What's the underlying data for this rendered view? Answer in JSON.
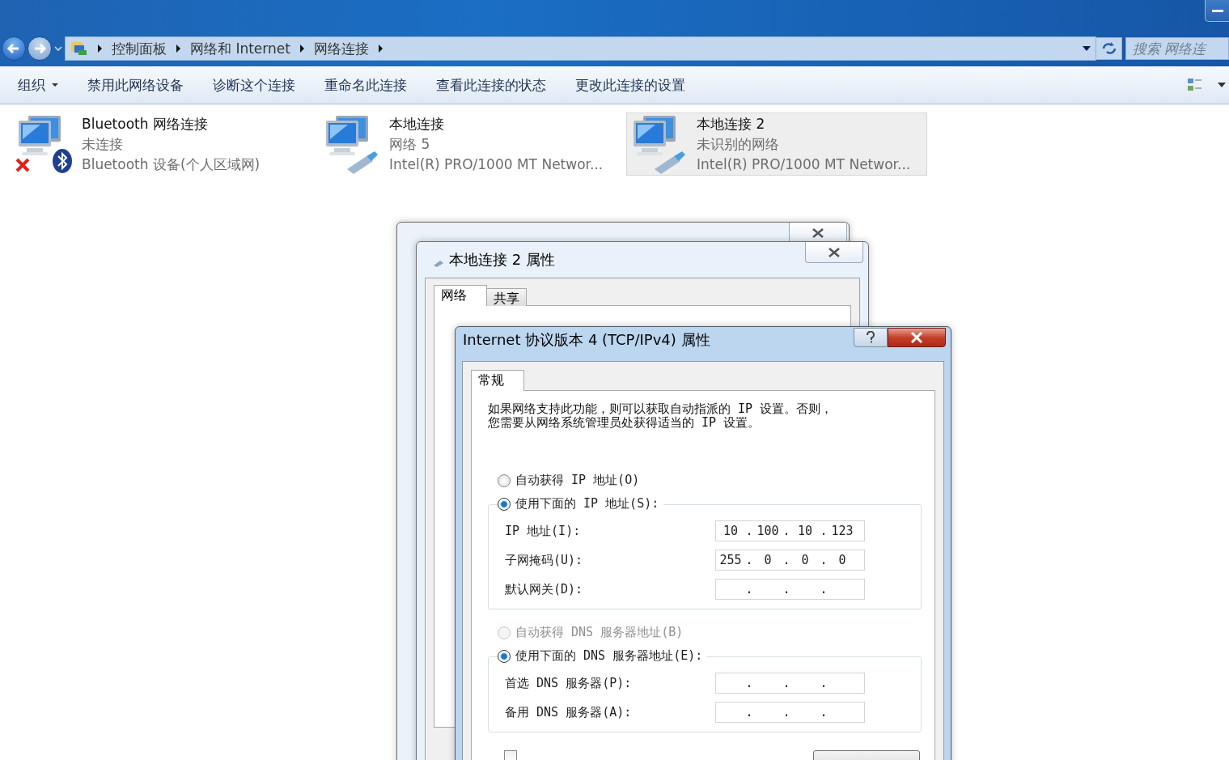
{
  "explorer": {
    "breadcrumb": [
      "控制面板",
      "网络和 Internet",
      "网络连接"
    ],
    "search": {
      "placeholder": "搜索 网络连"
    }
  },
  "toolbar": [
    {
      "label": "组织",
      "dropdown": true
    },
    {
      "label": "禁用此网络设备",
      "dropdown": false
    },
    {
      "label": "诊断这个连接",
      "dropdown": false
    },
    {
      "label": "重命名此连接",
      "dropdown": false
    },
    {
      "label": "查看此连接的状态",
      "dropdown": false
    },
    {
      "label": "更改此连接的设置",
      "dropdown": false
    }
  ],
  "connections": [
    {
      "kind": "bluetooth",
      "name": "Bluetooth 网络连接",
      "status": "未连接",
      "device": "Bluetooth 设备(个人区域网)",
      "disconnected": true,
      "selected": false
    },
    {
      "kind": "ethernet",
      "name": "本地连接",
      "status": "网络  5",
      "device": "Intel(R) PRO/1000 MT Networ...",
      "disconnected": false,
      "selected": false
    },
    {
      "kind": "ethernet",
      "name": "本地连接 2",
      "status": "未识别的网络",
      "device": "Intel(R) PRO/1000 MT Networ...",
      "disconnected": false,
      "selected": true
    }
  ],
  "properties_dialog": {
    "title": "本地连接 2 属性",
    "tabs": [
      {
        "label": "网络",
        "selected": true
      },
      {
        "label": "共享",
        "selected": false
      }
    ]
  },
  "ipv4_dialog": {
    "title": "Internet 协议版本 4 (TCP/IPv4) 属性",
    "tabs": [
      {
        "label": "常规",
        "selected": true
      }
    ],
    "description": [
      "如果网络支持此功能，则可以获取自动指派的 IP 设置。否则，",
      "您需要从网络系统管理员处获得适当的 IP 设置。"
    ],
    "separator": ".",
    "groups": [
      {
        "options": [
          {
            "label": "自动获得 IP 地址(O)",
            "selected": false,
            "disabled": false
          },
          {
            "label": "使用下面的 IP 地址(S):",
            "selected": true,
            "disabled": false
          }
        ],
        "fields": [
          {
            "label": "IP 地址(I):",
            "octets": [
              "10",
              "100",
              "10",
              "123"
            ]
          },
          {
            "label": "子网掩码(U):",
            "octets": [
              "255",
              "0",
              "0",
              "0"
            ]
          },
          {
            "label": "默认网关(D):"
          }
        ]
      },
      {
        "options": [
          {
            "label": "自动获得 DNS 服务器地址(B)",
            "selected": false,
            "disabled": true
          },
          {
            "label": "使用下面的 DNS 服务器地址(E):",
            "selected": true,
            "disabled": false
          }
        ],
        "fields": [
          {
            "label": "首选 DNS 服务器(P):"
          },
          {
            "label": "备用 DNS 服务器(A):"
          }
        ]
      }
    ],
    "validate": {
      "checked": false
    }
  }
}
